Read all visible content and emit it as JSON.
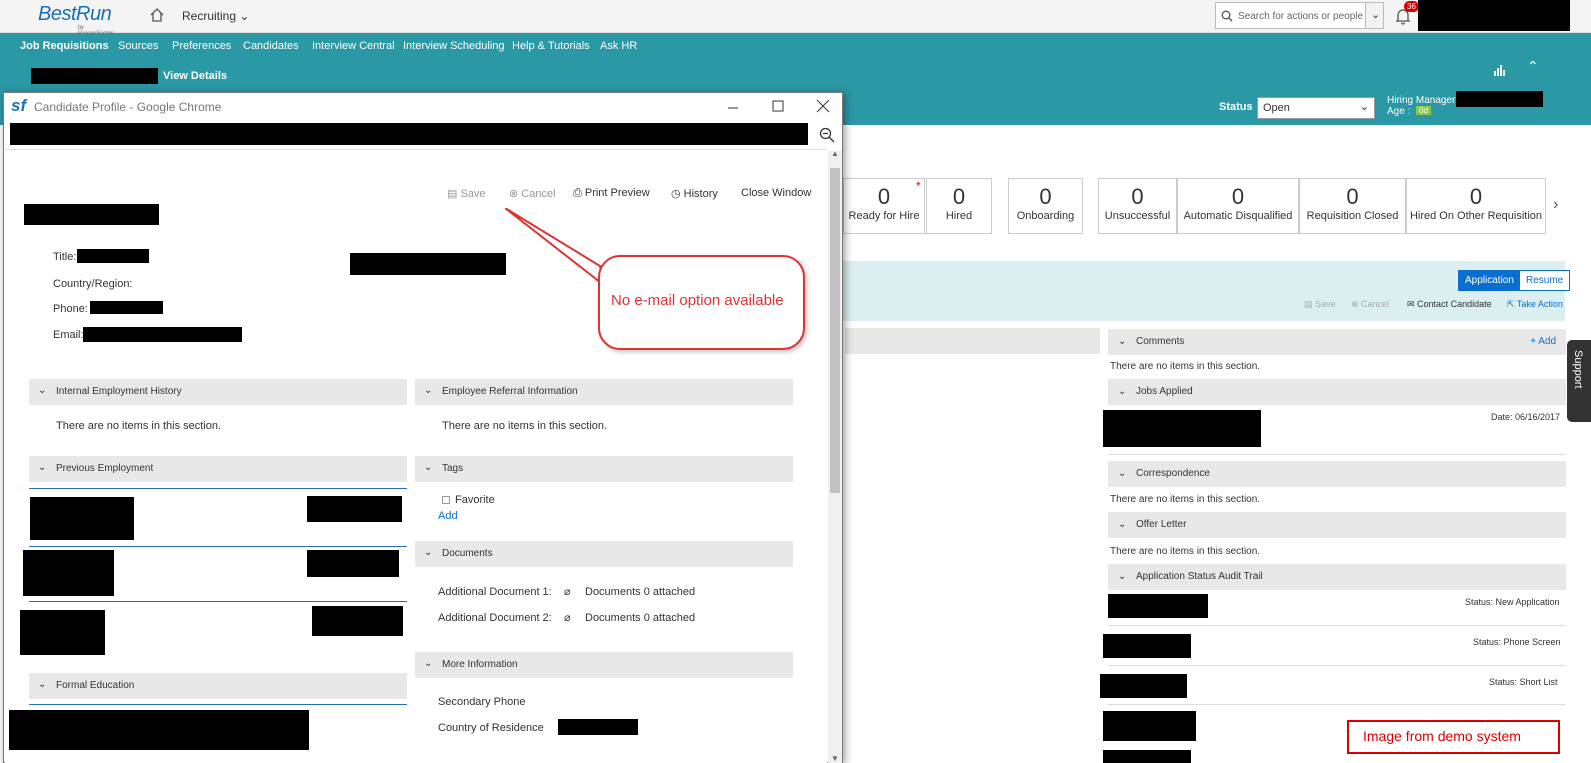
{
  "top": {
    "logo": "BestRun",
    "logo_sub": "by SuccessFactors",
    "module": "Recruiting",
    "search_placeholder": "Search for actions or people",
    "notification_count": "36"
  },
  "nav": [
    "Job Requisitions",
    "Sources",
    "Preferences",
    "Candidates",
    "Interview Central",
    "Interview Scheduling",
    "Help & Tutorials",
    "Ask HR"
  ],
  "header": {
    "view_details": "View Details",
    "status_label": "Status",
    "status_value": "Open",
    "hiring_manager": "Hiring Manager",
    "age_label": "Age :",
    "age_value": "0d"
  },
  "pipeline": [
    {
      "count": "0",
      "label": "Ready for Hire",
      "star": "*"
    },
    {
      "count": "0",
      "label": "Hired"
    },
    {
      "count": "0",
      "label": "Onboarding"
    },
    {
      "count": "0",
      "label": "Unsuccessful"
    },
    {
      "count": "0",
      "label": "Automatic Disqualified"
    },
    {
      "count": "0",
      "label": "Requisition Closed"
    },
    {
      "count": "0",
      "label": "Hired On Other Requisition"
    }
  ],
  "app_panel": {
    "tab_application": "Application",
    "tab_resume": "Resume",
    "save": "Save",
    "cancel": "Cancel",
    "contact": "Contact Candidate",
    "take_action": "Take Action",
    "comments": "Comments",
    "add": "+ Add",
    "no_items": "There are no items in this section.",
    "jobs_applied": "Jobs Applied",
    "date": "Date: 06/16/2017",
    "correspondence": "Correspondence",
    "offer_letter": "Offer Letter",
    "audit_trail": "Application Status Audit Trail",
    "statuses": [
      "Status: New Application",
      "Status: Phone Screen",
      "Status: Short List"
    ]
  },
  "popup": {
    "title": "Candidate Profile - Google Chrome",
    "toolbar": {
      "save": "Save",
      "cancel": "Cancel",
      "print": "Print Preview",
      "history": "History",
      "close": "Close Window"
    },
    "fields": {
      "title": "Title:",
      "country": "Country/Region:",
      "phone": "Phone:",
      "email": "Email:"
    },
    "sections": {
      "internal": "Internal Employment History",
      "referral": "Employee Referral Information",
      "previous": "Previous Employment",
      "tags": "Tags",
      "documents": "Documents",
      "formal": "Formal Education",
      "more": "More Information"
    },
    "no_items": "There are no items in this section.",
    "favorite": "Favorite",
    "add": "Add",
    "doc1": "Additional Document 1:",
    "doc2": "Additional Document 2:",
    "attached": "Documents 0 attached",
    "secondary_phone": "Secondary Phone",
    "country_residence": "Country of Residence"
  },
  "callout": "No e-mail option available",
  "support": "Support",
  "demo_note": "Image from demo system",
  "colors": {
    "teal": "#2b98a5",
    "blue": "#0a6ed1",
    "red": "#d33"
  }
}
